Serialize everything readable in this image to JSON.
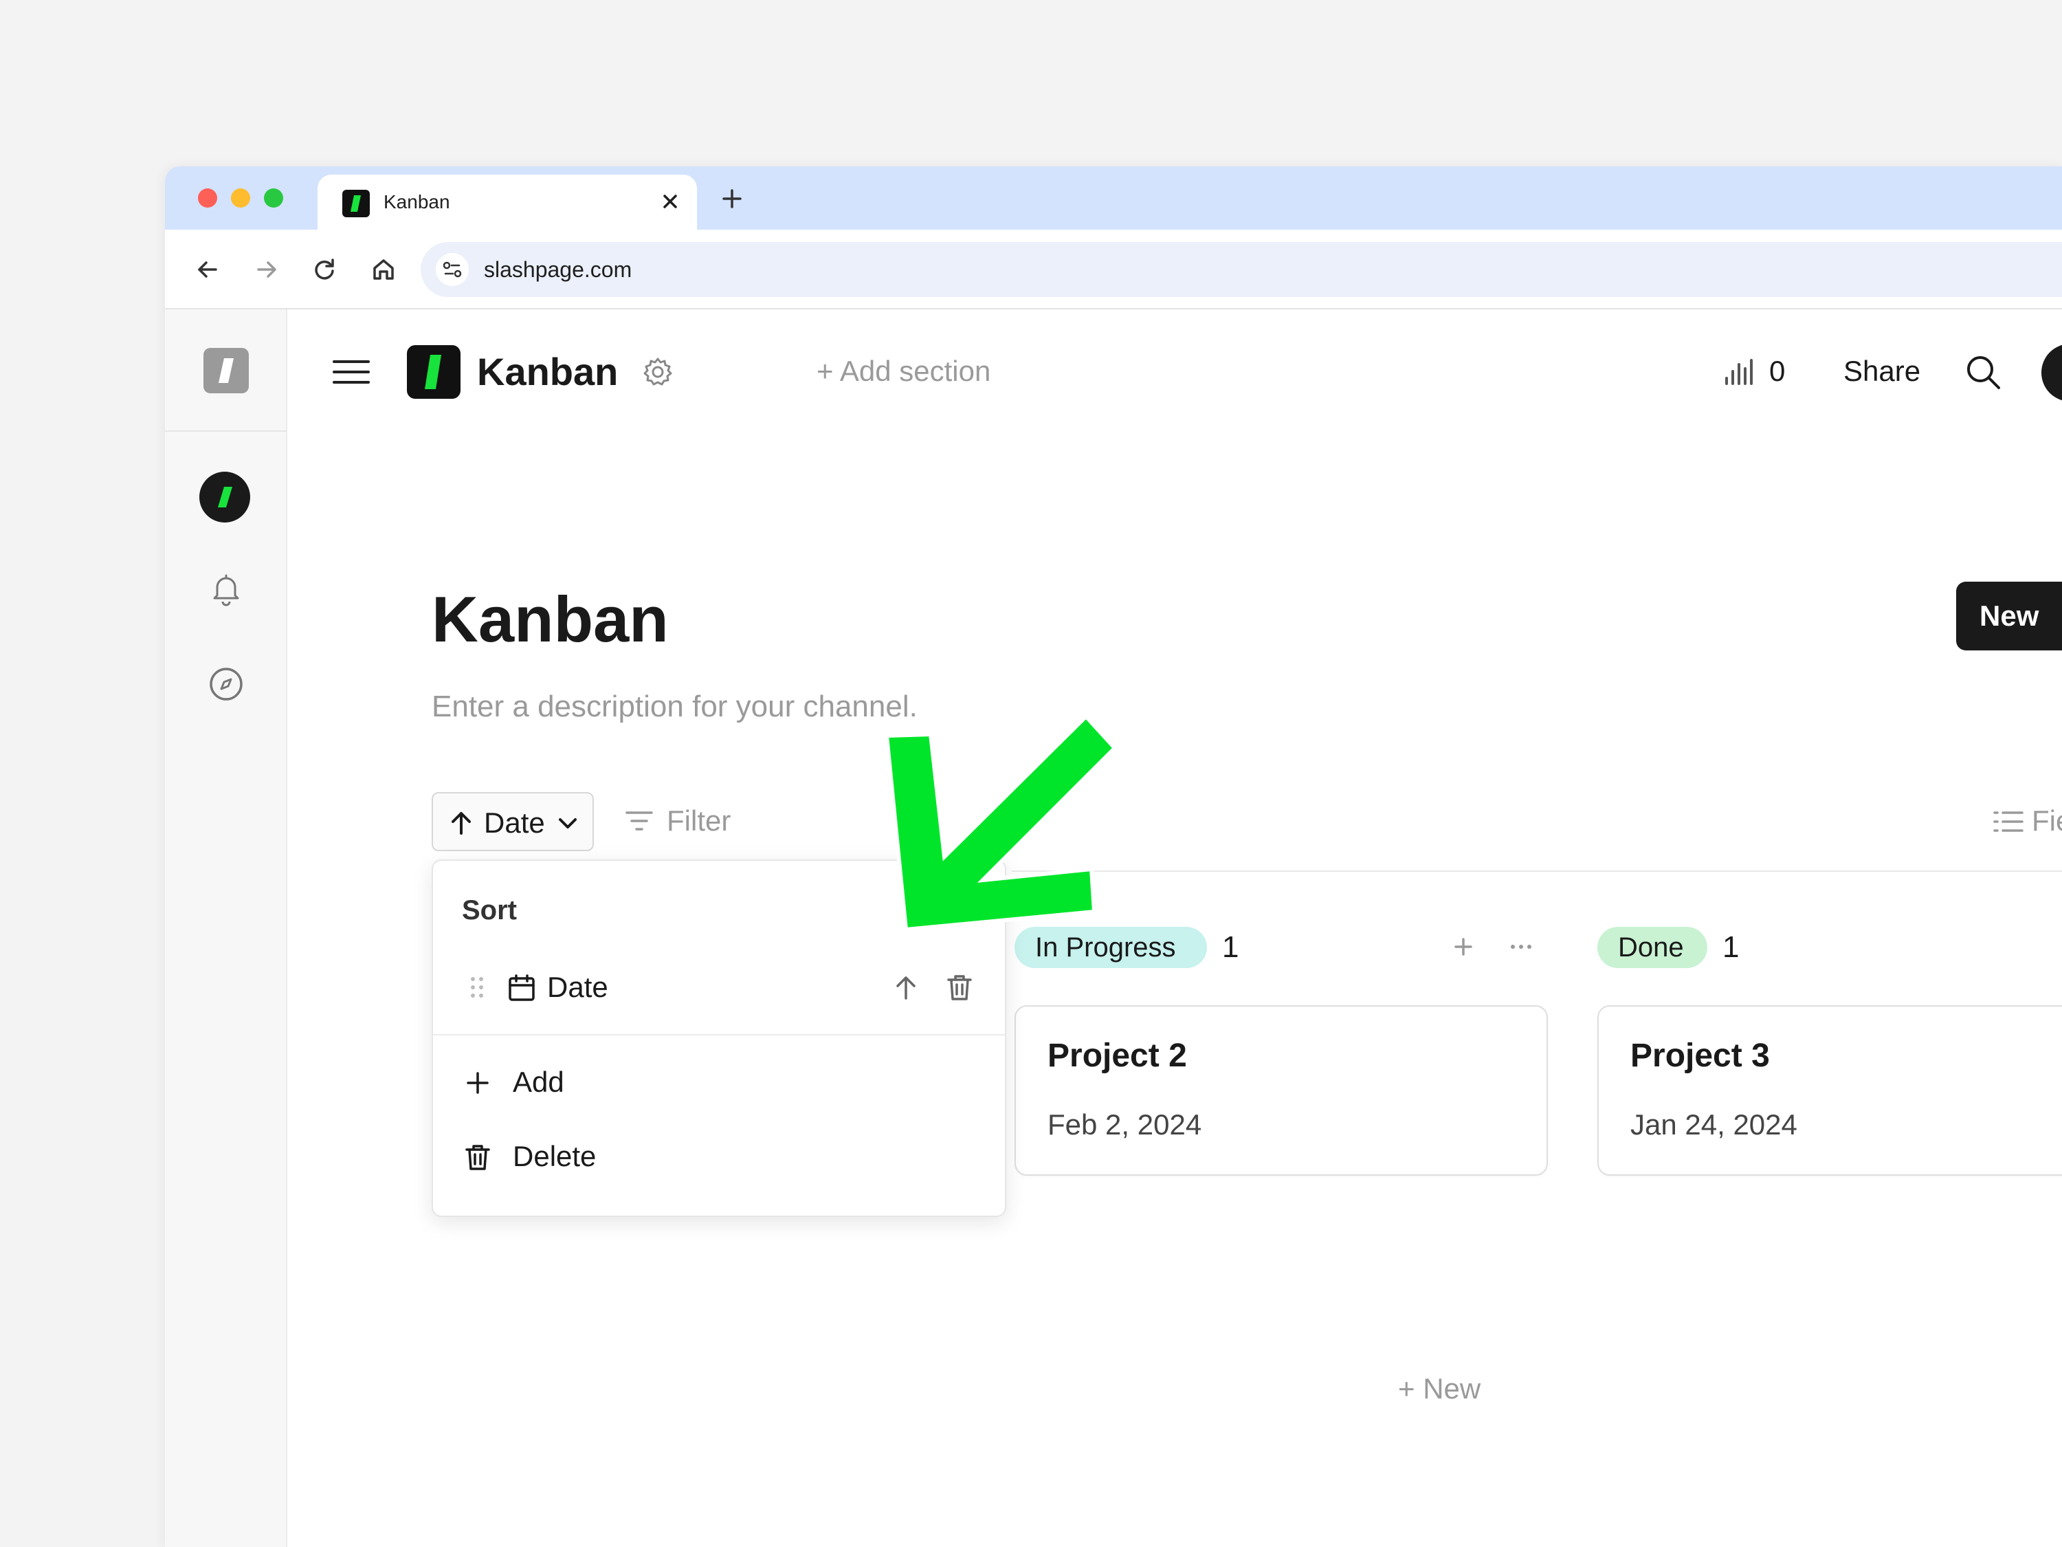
{
  "browser": {
    "tab_title": "Kanban",
    "url": "slashpage.com",
    "colors": {
      "tabstrip": "#d3e3fd",
      "close": "#fe5f57",
      "minimize": "#febc2e",
      "maximize": "#28c840"
    }
  },
  "header": {
    "title": "Kanban",
    "add_section_label": "+ Add section",
    "view_count": "0",
    "share_label": "Share"
  },
  "page": {
    "title": "Kanban",
    "description": "Enter a description for your channel.",
    "new_button_label": "New"
  },
  "toolbar": {
    "sort_label": "Date",
    "filter_label": "Filter",
    "fields_label": "Fie"
  },
  "sort_popover": {
    "title": "Sort",
    "rule_label": "Date",
    "add_label": "Add",
    "delete_label": "Delete"
  },
  "columns": [
    {
      "label": "In Progress",
      "count": "1",
      "color": "#c7f2ee"
    },
    {
      "label": "Done",
      "count": "1",
      "color": "#c9f2d3"
    }
  ],
  "cards": [
    {
      "title": "Project 2",
      "date": "Feb 2, 2024"
    },
    {
      "title": "Project 3",
      "date": "Jan 24, 2024"
    }
  ],
  "column_new_label": "+ New",
  "accent_color": "#00e52a"
}
